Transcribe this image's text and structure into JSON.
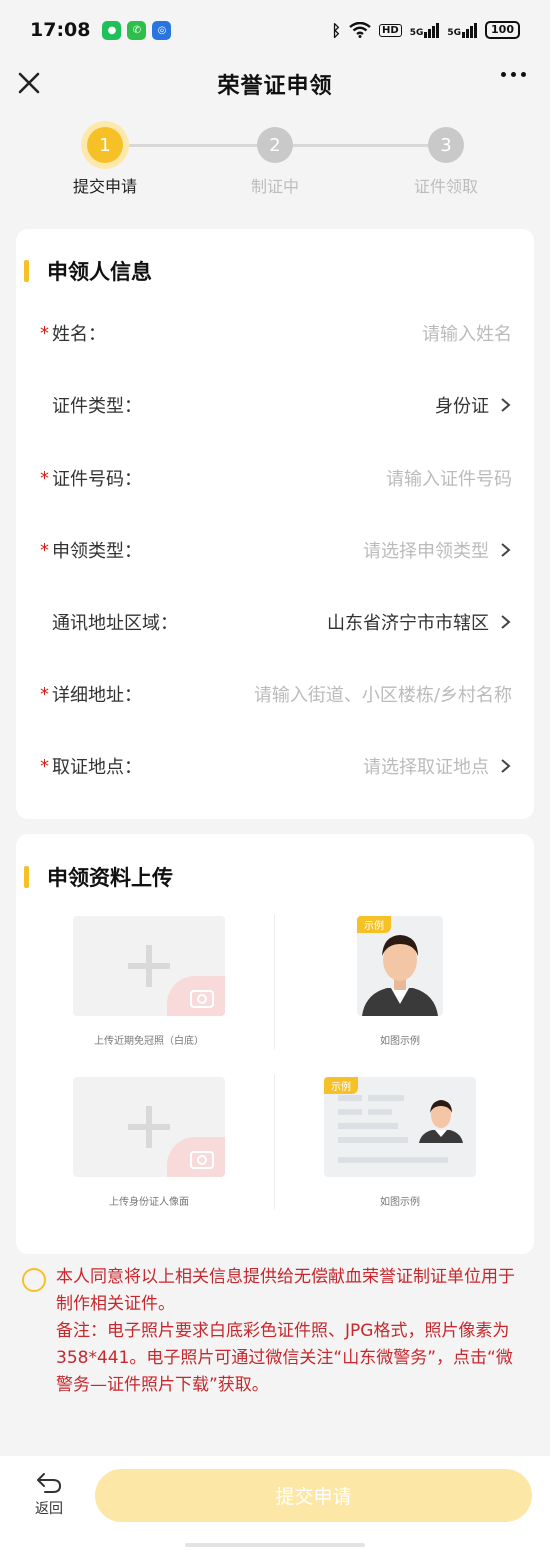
{
  "status_bar": {
    "time": "17:08",
    "network_label_1": "5G",
    "network_label_2": "5G",
    "hd_label": "HD",
    "battery": "100"
  },
  "nav": {
    "title": "荣誉证申领"
  },
  "steps": [
    {
      "number": "1",
      "label": "提交申请"
    },
    {
      "number": "2",
      "label": "制证中"
    },
    {
      "number": "3",
      "label": "证件领取"
    }
  ],
  "applicant": {
    "section_title": "申领人信息",
    "fields": [
      {
        "label": "姓名：",
        "value": "请输入姓名"
      },
      {
        "label": "证件类型：",
        "value": "身份证"
      },
      {
        "label": "证件号码：",
        "value": "请输入证件号码"
      },
      {
        "label": "申领类型：",
        "value": "请选择申领类型"
      },
      {
        "label": "通讯地址区域：",
        "value": "山东省济宁市市辖区"
      },
      {
        "label": "详细地址：",
        "value": "请输入街道、小区楼栋/乡村名称"
      },
      {
        "label": "取证地点：",
        "value": "请选择取证地点"
      }
    ],
    "required_mark": "*"
  },
  "upload": {
    "section_title": "申领资料上传",
    "photo_caption": "上传近期免冠照（白底）",
    "photo_example_caption": "如图示例",
    "id_caption": "上传身份证人像面",
    "id_example_caption": "如图示例",
    "example_tag": "示例"
  },
  "agreement": {
    "line1": "本人同意将以上相关信息提供给无偿献血荣誉证制证单位用于制作相关证件。",
    "line2": "备注：电子照片要求白底彩色证件照、JPG格式，照片像素为358*441。电子照片可通过微信关注“山东微警务”，点击“微警务—证件照片下载”获取。"
  },
  "bottom": {
    "back_label": "返回",
    "submit_label": "提交申请"
  },
  "colors": {
    "accent": "#f6c127",
    "required": "#d0211c",
    "notice": "#c7282d"
  }
}
